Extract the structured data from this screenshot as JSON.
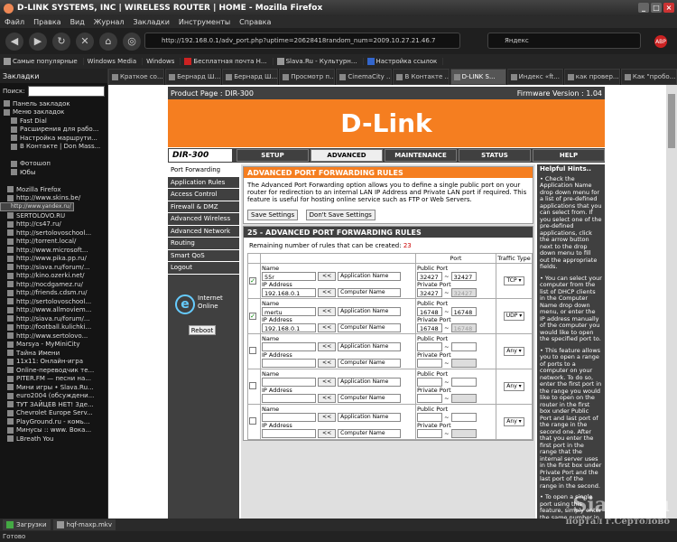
{
  "window": {
    "title": "D-LINK SYSTEMS, INC | WIRELESS ROUTER | HOME - Mozilla Firefox"
  },
  "menu": [
    "Файл",
    "Правка",
    "Вид",
    "Журнал",
    "Закладки",
    "Инструменты",
    "Справка"
  ],
  "nav": {
    "url": "http://192.168.0.1/adv_port.php?uptime=20628418random_num=2009.10.27.21.46.7",
    "search": "Яндекс"
  },
  "bookmarks": [
    "Самые популярные",
    "Windows Media",
    "Windows",
    "Бесплатная почта Н...",
    "Slava.Ru - Культурн...",
    "Настройка ссылок"
  ],
  "sidebar": {
    "title": "Закладки",
    "search_label": "Поиск:",
    "items": [
      "Панель закладок",
      "Меню закладок",
      "Fast Dial",
      "Расширения для рабо...",
      "Настройка маршрути...",
      "В Контакте | Don Mass...",
      "",
      "Фотошоп",
      "Юбы",
      "",
      "Mozilla Firefox",
      "http://www.skins.be/",
      "http://www.yandex.ru/",
      "SERTOLOVO.RU",
      "http://cs47.ru/",
      "http://sertolovoschool...",
      "http://torrent.local/",
      "http://www.microsoft...",
      "http://www.pika.pp.ru/",
      "http://siava.ru/forum/...",
      "http://kino.ozerki.net/",
      "http://nocdgamez.ru/",
      "http://friends.cdsm.ru/",
      "http://sertolovoschool...",
      "http://www.allmoviem...",
      "http://siava.ru/forum/...",
      "http://football.kulichki...",
      "http://www.sertolovo...",
      "Marsya - MyMiniCity",
      "Тайна Имени",
      "11x11: Онлайн-игра",
      "Online-переводчик те...",
      "PITER.FM — песни на...",
      "Мини игры • Slava.Ru...",
      "euro2004 (обсуждени...",
      "ТУТ ЗАЙЦЕВ НЕТ! Зде...",
      "Chevrolet Europe Serv...",
      "PlayGround.ru - комь...",
      "Минусы :: www. Вока...",
      "LBreath You"
    ]
  },
  "tabs": [
    "Краткое со...",
    "Бернард Ш...",
    "Бернард Ш...",
    "Просмотр п...",
    "CinemaCity ...",
    "В Контакте ...",
    "D-LINK S...",
    "Индекс «ft...",
    "как провер...",
    "Как \"пробо..."
  ],
  "router": {
    "product_page": "Product Page : DIR-300",
    "firmware": "Firmware Version : 1.04",
    "logo": "D-Link",
    "model": "DIR-300",
    "main_tabs": [
      "SETUP",
      "ADVANCED",
      "MAINTENANCE",
      "STATUS",
      "HELP"
    ],
    "left_nav": [
      "Port Forwarding",
      "Application Rules",
      "Access Control",
      "Firewall & DMZ",
      "Advanced Wireless",
      "Advanced Network",
      "Routing",
      "Smart QoS",
      "Logout"
    ],
    "internet_status": "Internet Online",
    "reboot_label": "Reboot",
    "section_title": "ADVANCED PORT FORWARDING RULES",
    "section_desc": "The Advanced Port Forwarding option allows you to define a single public port on your router for redirection to an internal LAN IP Address and Private LAN port if required. This feature is useful for hosting online service such as FTP or Web Servers.",
    "save_label": "Save Settings",
    "dont_save_label": "Don't Save Settings",
    "rules_title": "25 - ADVANCED PORT FORWARDING RULES",
    "remaining_text": "Remaining number of rules that can be created:",
    "remaining_count": "23",
    "col_port": "Port",
    "col_traffic": "Traffic Type",
    "name_label": "Name",
    "ip_label": "IP Address",
    "public_label": "Public Port",
    "private_label": "Private Port",
    "app_name": "Application Name",
    "computer_name": "Computer Name",
    "rules": [
      {
        "checked": true,
        "name": "55r",
        "ip": "192.168.0.1",
        "pub_from": "32427",
        "pub_to": "32427",
        "priv_from": "32427",
        "priv_to": "32427",
        "type": "TCP"
      },
      {
        "checked": true,
        "name": "mertu",
        "ip": "192.168.0.1",
        "pub_from": "16748",
        "pub_to": "16748",
        "priv_from": "16748",
        "priv_to": "16748",
        "type": "UDP"
      },
      {
        "checked": false,
        "name": "",
        "ip": "",
        "pub_from": "",
        "pub_to": "",
        "priv_from": "",
        "priv_to": "",
        "type": "Any"
      },
      {
        "checked": false,
        "name": "",
        "ip": "",
        "pub_from": "",
        "pub_to": "",
        "priv_from": "",
        "priv_to": "",
        "type": "Any"
      },
      {
        "checked": false,
        "name": "",
        "ip": "",
        "pub_from": "",
        "pub_to": "",
        "priv_from": "",
        "priv_to": "",
        "type": "Any"
      }
    ],
    "hints_title": "Helpful Hints..",
    "hints": [
      "• Check the Application Name drop down menu for a list of pre-defined applications that you can select from. If you select one of the pre-defined applications, click the arrow button next to the drop down menu to fill out the appropriate fields.",
      "• You can select your computer from the list of DHCP clients in the Computer Name drop down menu, or enter the IP address manually of the computer you would like to open the specified port to.",
      "• This feature allows you to open a range of ports to a computer on your network. To do so, enter the first port in the range you would like to open on the router in the first box under Public Port and last port of the range in the second one. After that you enter the first port in the range that the internal server uses in the first box under Private Port and the last port of the range in the second.",
      "• To open a single port using this feature, simply enter the same number in both boxes."
    ]
  },
  "taskbar": [
    "Загрузки",
    "hqf-maxp.mkv"
  ],
  "status": "Готово",
  "watermark": {
    "line1": "Siava.Ru",
    "line2": "портал г.Сертолово"
  }
}
